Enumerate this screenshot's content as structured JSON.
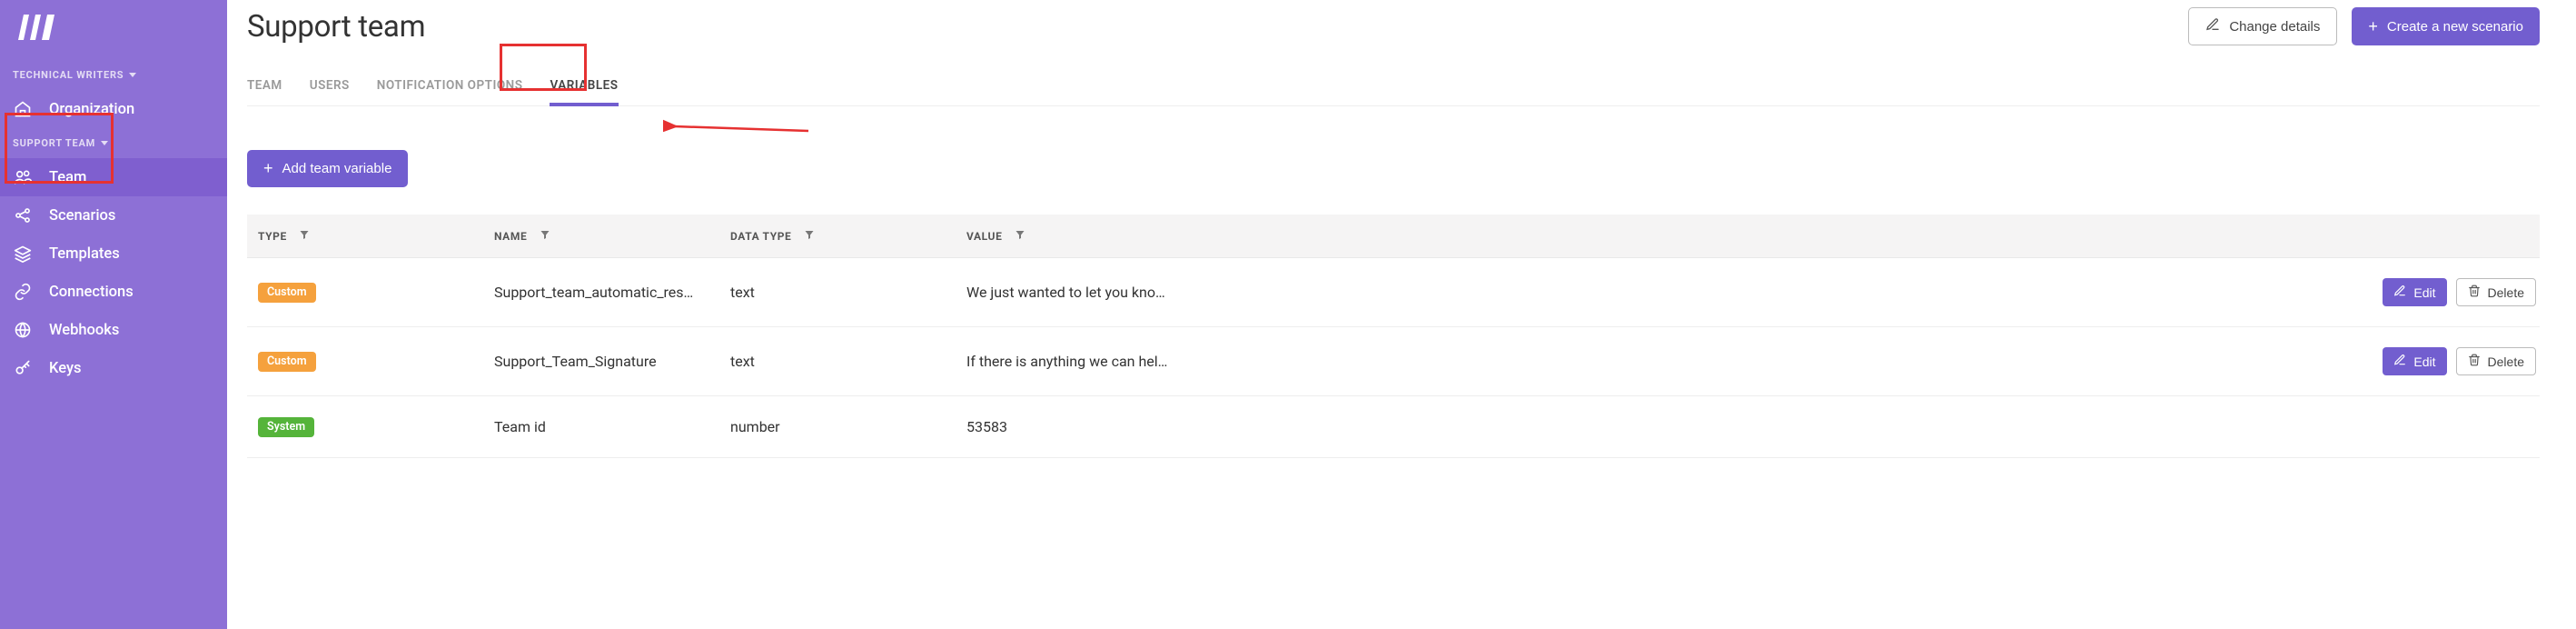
{
  "sidebar": {
    "sections": [
      {
        "label": "TECHNICAL WRITERS"
      },
      {
        "label": "SUPPORT TEAM"
      }
    ],
    "organization": "Organization",
    "items": [
      {
        "label": "Team",
        "icon": "users-icon",
        "active": true
      },
      {
        "label": "Scenarios",
        "icon": "share-icon",
        "active": false
      },
      {
        "label": "Templates",
        "icon": "layers-icon",
        "active": false
      },
      {
        "label": "Connections",
        "icon": "link-icon",
        "active": false
      },
      {
        "label": "Webhooks",
        "icon": "globe-icon",
        "active": false
      },
      {
        "label": "Keys",
        "icon": "key-icon",
        "active": false
      }
    ]
  },
  "header": {
    "title": "Support team",
    "change_details": "Change details",
    "create_scenario": "Create a new scenario"
  },
  "tabs": [
    {
      "label": "TEAM",
      "active": false
    },
    {
      "label": "USERS",
      "active": false
    },
    {
      "label": "NOTIFICATION OPTIONS",
      "active": false
    },
    {
      "label": "VARIABLES",
      "active": true
    }
  ],
  "actions": {
    "add_variable": "Add team variable",
    "edit": "Edit",
    "delete": "Delete"
  },
  "table": {
    "columns": {
      "type": "TYPE",
      "name": "NAME",
      "data_type": "DATA TYPE",
      "value": "VALUE"
    },
    "rows": [
      {
        "type": "Custom",
        "type_class": "custom",
        "name": "Support_team_automatic_res…",
        "data_type": "text",
        "value": "We just wanted to let you kno…",
        "actions": true
      },
      {
        "type": "Custom",
        "type_class": "custom",
        "name": "Support_Team_Signature",
        "data_type": "text",
        "value": "If there is anything we can hel…",
        "actions": true
      },
      {
        "type": "System",
        "type_class": "system",
        "name": "Team id",
        "data_type": "number",
        "value": "53583",
        "actions": false
      }
    ]
  }
}
